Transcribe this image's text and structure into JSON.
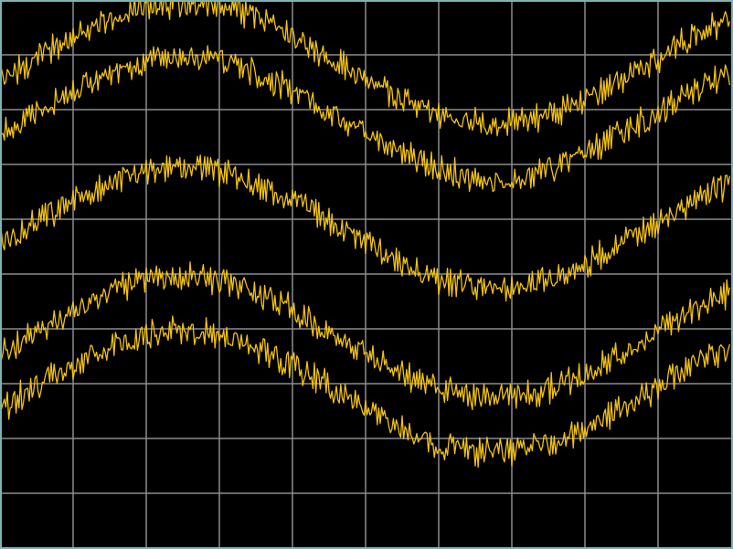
{
  "chart_data": {
    "type": "line",
    "title": "",
    "xlabel": "",
    "ylabel": "",
    "grid": true,
    "grid_divisions": {
      "x": 10,
      "y": 10
    },
    "xlim": [
      0,
      10
    ],
    "ylim": [
      0,
      10
    ],
    "colors": {
      "background": "#000000",
      "grid": "#8c8c8c",
      "border": "#7fb3b3",
      "trace": "#f2c20f"
    },
    "waveform": {
      "shape": "sine-with-noise",
      "period_divisions": 8.5,
      "amplitude_divisions": 1.1,
      "phase_peak_at_division": 2.5,
      "noise_amplitude_divisions": 0.22
    },
    "series": [
      {
        "baseline_division": 1.15
      },
      {
        "baseline_division": 2.15
      },
      {
        "baseline_division": 4.15
      },
      {
        "baseline_division": 6.15
      },
      {
        "baseline_division": 7.15
      }
    ]
  }
}
